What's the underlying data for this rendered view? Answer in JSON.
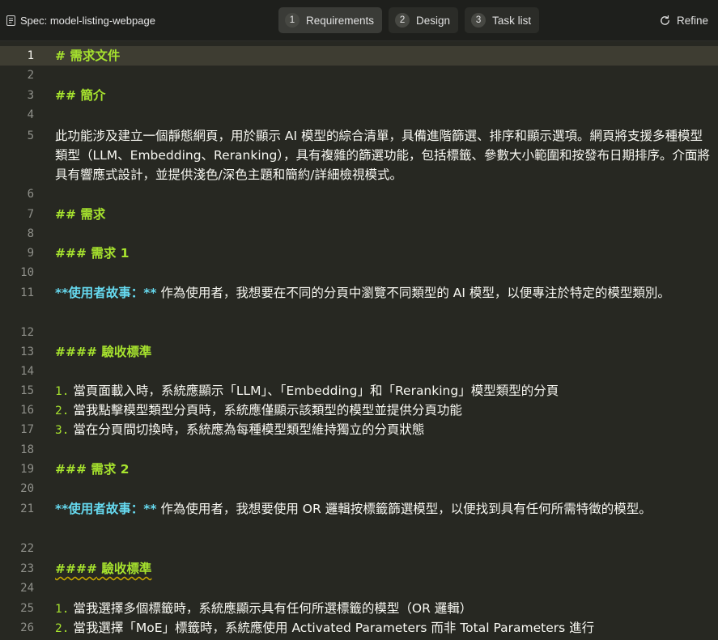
{
  "header": {
    "spec_title": "Spec: model-listing-webpage",
    "tabs": [
      {
        "num": "1",
        "label": "Requirements",
        "active": true
      },
      {
        "num": "2",
        "label": "Design"
      },
      {
        "num": "3",
        "label": "Task list"
      }
    ],
    "refine_label": "Refine"
  },
  "editor": {
    "line_numbers": [
      "1",
      "2",
      "3",
      "4",
      "5",
      "6",
      "7",
      "8",
      "9",
      "10",
      "11",
      "12",
      "13",
      "14",
      "15",
      "16",
      "17",
      "18",
      "19",
      "20",
      "21",
      "22",
      "23",
      "24",
      "25",
      "26"
    ],
    "l1": "# 需求文件",
    "l3": "## 簡介",
    "l5": "此功能涉及建立一個靜態網頁，用於顯示 AI 模型的綜合清單，具備進階篩選、排序和顯示選項。網頁將支援多種模型類型（LLM、Embedding、Reranking），具有複雜的篩選功能，包括標籤、參數大小範圍和按發布日期排序。介面將具有響應式設計，並提供淺色/深色主題和簡約/詳細檢視模式。",
    "l7": "## 需求",
    "l9": "### 需求 1",
    "l11_bold": "**使用者故事：**",
    "l11_text": " 作為使用者，我想要在不同的分頁中瀏覽不同類型的 AI 模型，以便專注於特定的模型類別。",
    "l13": "#### 驗收標準",
    "l15_num": "1.",
    "l15": " 當頁面載入時，系統應顯示「LLM」、「Embedding」和「Reranking」模型類型的分頁",
    "l16_num": "2.",
    "l16": " 當我點擊模型類型分頁時，系統應僅顯示該類型的模型並提供分頁功能",
    "l17_num": "3.",
    "l17": " 當在分頁間切換時，系統應為每種模型類型維持獨立的分頁狀態",
    "l19": "### 需求 2",
    "l21_bold": "**使用者故事：**",
    "l21_text": " 作為使用者，我想要使用 OR 邏輯按標籤篩選模型，以便找到具有任何所需特徵的模型。",
    "l23_hash": "####",
    "l23_text": " 驗收標準",
    "l25_num": "1.",
    "l25": " 當我選擇多個標籤時，系統應顯示具有任何所選標籤的模型（OR 邏輯）",
    "l26_num": "2.",
    "l26": " 當我選擇「MoE」標籤時，系統應使用 Activated Parameters 而非 Total Parameters 進行"
  }
}
